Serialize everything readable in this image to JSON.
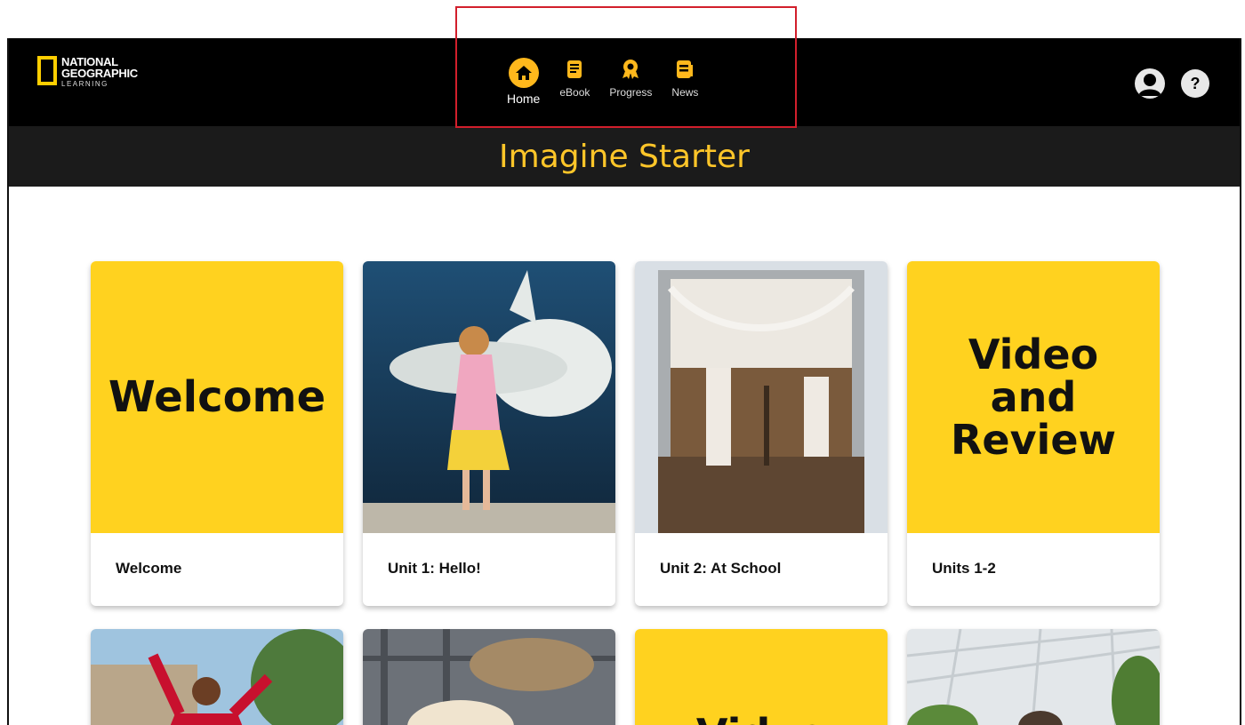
{
  "brand": {
    "line1": "NATIONAL",
    "line2": "GEOGRAPHIC",
    "line3": "LEARNING"
  },
  "nav": {
    "items": [
      {
        "label": "Home",
        "icon": "home-icon",
        "active": true
      },
      {
        "label": "eBook",
        "icon": "ebook-icon"
      },
      {
        "label": "Progress",
        "icon": "award-icon"
      },
      {
        "label": "News",
        "icon": "news-icon"
      }
    ]
  },
  "header": {
    "profile_icon": "user-icon",
    "help_icon": "?"
  },
  "page": {
    "title": "Imagine Starter"
  },
  "cards": [
    {
      "image_text": "Welcome",
      "caption": "Welcome"
    },
    {
      "image": "girl-beluga-photo",
      "caption": "Unit 1: Hello!"
    },
    {
      "image": "school-net-photo",
      "caption": "Unit 2: At School"
    },
    {
      "image_text": "Video and Review",
      "image_lines": [
        "Video",
        "and",
        "Review"
      ],
      "caption": "Units 1-2"
    },
    {
      "image": "boy-red-jacket-photo"
    },
    {
      "image": "lamb-photo"
    },
    {
      "image_text": "Video"
    },
    {
      "image": "greenhouse-photo"
    }
  ],
  "colors": {
    "accent": "#ffb81c",
    "title": "#ffc629",
    "card_yellow": "#ffd21f",
    "highlight": "#d21f2c"
  }
}
